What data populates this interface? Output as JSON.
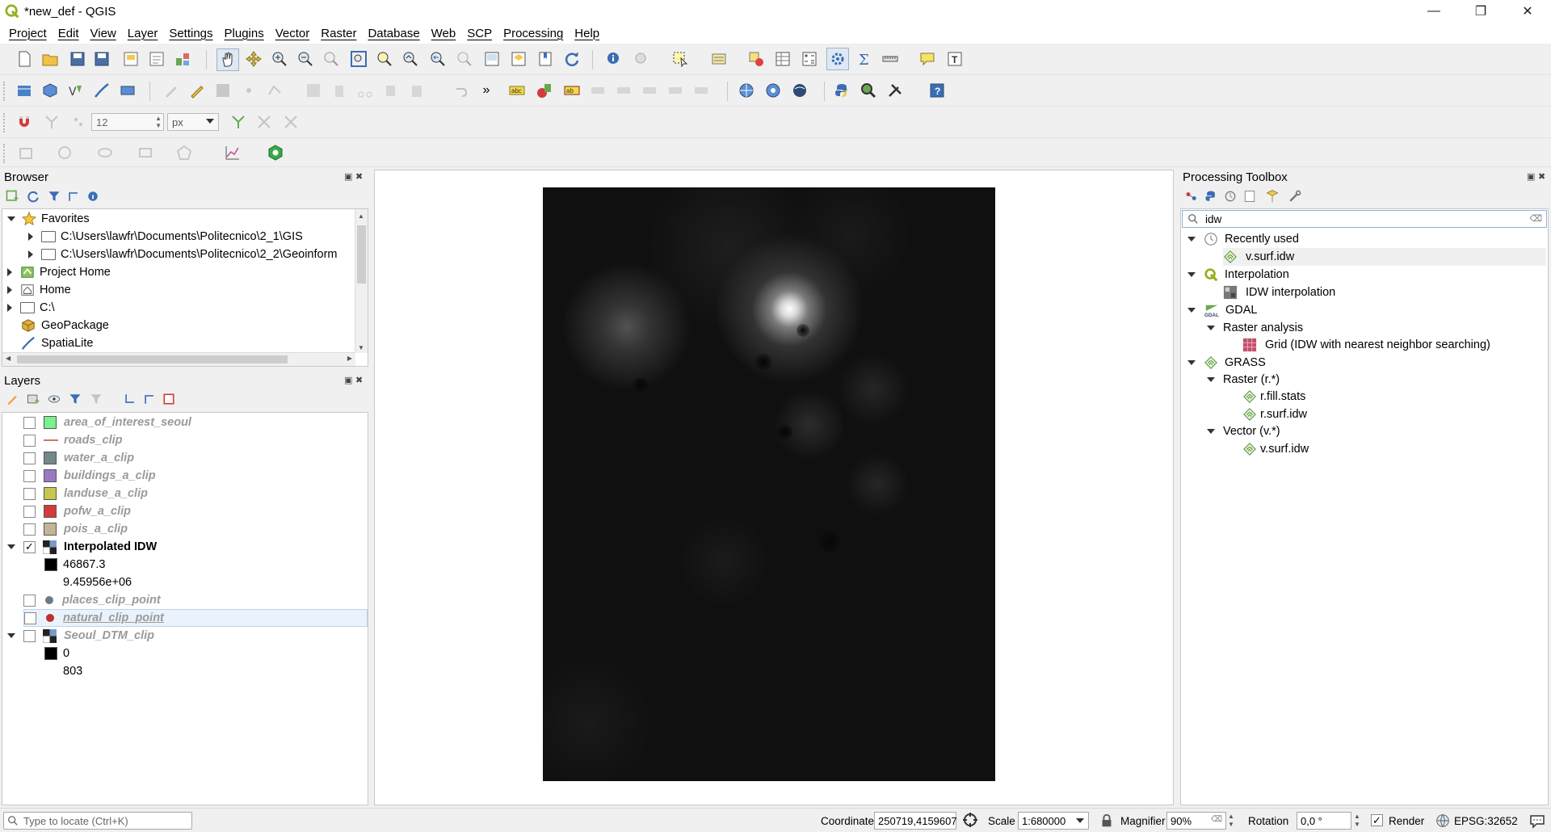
{
  "window": {
    "title": "*new_def - QGIS",
    "minimize": "—",
    "restore": "❐",
    "close": "✕"
  },
  "menu": [
    "Project",
    "Edit",
    "View",
    "Layer",
    "Settings",
    "Plugins",
    "Vector",
    "Raster",
    "Database",
    "Web",
    "SCP",
    "Processing",
    "Help"
  ],
  "snapping": {
    "tolerance": "12",
    "unit": "px"
  },
  "browser": {
    "title": "Browser",
    "items": [
      {
        "label": "Favorites",
        "icon": "star-icon",
        "expanded": true,
        "level": 0
      },
      {
        "label": "C:\\Users\\lawfr\\Documents\\Politecnico\\2_1\\GIS",
        "icon": "folder-icon",
        "level": 1
      },
      {
        "label": "C:\\Users\\lawfr\\Documents\\Politecnico\\2_2\\Geoinform",
        "icon": "folder-icon",
        "level": 1
      },
      {
        "label": "Project Home",
        "icon": "project-home-icon",
        "level": 0
      },
      {
        "label": "Home",
        "icon": "home-icon",
        "level": 0
      },
      {
        "label": "C:\\",
        "icon": "folder-icon",
        "level": 0
      },
      {
        "label": "GeoPackage",
        "icon": "geopackage-icon",
        "level": 0
      },
      {
        "label": "SpatiaLite",
        "icon": "spatialite-icon",
        "level": 0
      }
    ]
  },
  "layers": {
    "title": "Layers",
    "items": [
      {
        "label": "area_of_interest_seoul",
        "checked": false,
        "color": "#7cf08c",
        "kind": "fill"
      },
      {
        "label": "roads_clip",
        "checked": false,
        "color": "#c07b6c",
        "kind": "line"
      },
      {
        "label": "water_a_clip",
        "checked": false,
        "color": "#74888a",
        "kind": "fill"
      },
      {
        "label": "buildings_a_clip",
        "checked": false,
        "color": "#9b78c4",
        "kind": "fill"
      },
      {
        "label": "landuse_a_clip",
        "checked": false,
        "color": "#c6c74e",
        "kind": "fill"
      },
      {
        "label": "pofw_a_clip",
        "checked": false,
        "color": "#d43b3b",
        "kind": "fill"
      },
      {
        "label": "pois_a_clip",
        "checked": false,
        "color": "#c2b596",
        "kind": "fill"
      }
    ],
    "idw": {
      "label": "Interpolated IDW",
      "min": "46867.3",
      "max": "9.45956e+06"
    },
    "places": {
      "label": "places_clip_point",
      "color": "#6b7b85"
    },
    "natural": {
      "label": "natural_clip_point",
      "color": "#c0302f"
    },
    "dtm": {
      "label": "Seoul_DTM_clip",
      "min": "0",
      "max": "803"
    }
  },
  "toolbox": {
    "title": "Processing Toolbox",
    "search": "idw",
    "items": [
      {
        "label": "Recently used",
        "icon": "clock-icon",
        "level": 0
      },
      {
        "label": "v.surf.idw",
        "icon": "grass-icon",
        "level": 2
      },
      {
        "label": "Interpolation",
        "icon": "qgis-icon",
        "level": 0
      },
      {
        "label": "IDW interpolation",
        "icon": "interpolation-icon",
        "level": 2
      },
      {
        "label": "GDAL",
        "icon": "gdal-icon",
        "level": 0
      },
      {
        "label": "Raster analysis",
        "icon": "",
        "level": 1
      },
      {
        "label": "Grid (IDW with nearest neighbor searching)",
        "icon": "grid-icon",
        "level": 3
      },
      {
        "label": "GRASS",
        "icon": "grass-icon",
        "level": 0
      },
      {
        "label": "Raster (r.*)",
        "icon": "",
        "level": 1
      },
      {
        "label": "r.fill.stats",
        "icon": "grass-icon",
        "level": 3
      },
      {
        "label": "r.surf.idw",
        "icon": "grass-icon",
        "level": 3
      },
      {
        "label": "Vector (v.*)",
        "icon": "",
        "level": 1
      },
      {
        "label": "v.surf.idw",
        "icon": "grass-icon",
        "level": 3
      }
    ]
  },
  "status": {
    "locate_placeholder": "Type to locate (Ctrl+K)",
    "coordinate_label": "Coordinate",
    "coordinate": "250719,4159607",
    "scale_label": "Scale",
    "scale": "1:680000",
    "magnifier_label": "Magnifier",
    "magnifier": "90%",
    "rotation_label": "Rotation",
    "rotation": "0,0 °",
    "render_label": "Render",
    "crs": "EPSG:32652"
  }
}
